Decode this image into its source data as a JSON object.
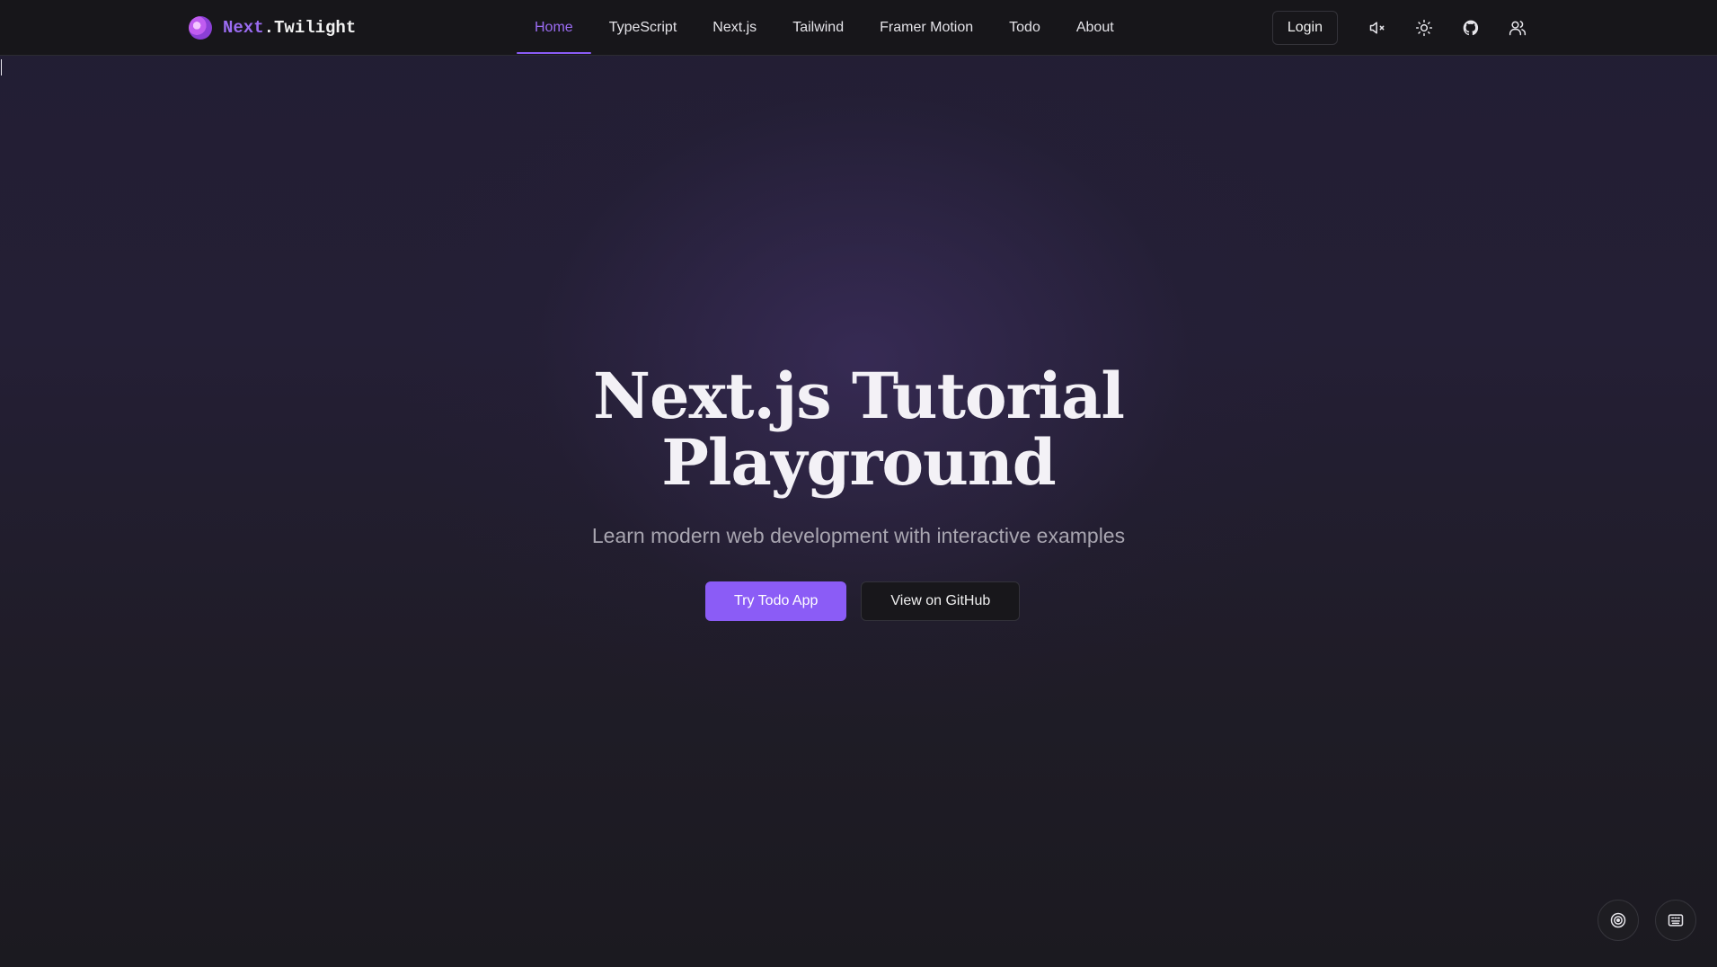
{
  "brand": {
    "prefix": "Next",
    "suffix": ".Twilight",
    "accent_color": "#8b5cf6"
  },
  "nav": {
    "items": [
      {
        "label": "Home",
        "active": true
      },
      {
        "label": "TypeScript",
        "active": false
      },
      {
        "label": "Next.js",
        "active": false
      },
      {
        "label": "Tailwind",
        "active": false
      },
      {
        "label": "Framer Motion",
        "active": false
      },
      {
        "label": "Todo",
        "active": false
      },
      {
        "label": "About",
        "active": false
      }
    ]
  },
  "header_tools": {
    "login_label": "Login",
    "icons": [
      "speaker-muted-icon",
      "sun-icon",
      "github-icon",
      "users-icon"
    ]
  },
  "hero": {
    "title_line1": "Next.js Tutorial",
    "title_line2": "Playground",
    "subtitle": "Learn modern web development with interactive examples",
    "primary_button": "Try Todo App",
    "secondary_button": "View on GitHub"
  },
  "floating_buttons": {
    "icons": [
      "target-icon",
      "keyboard-icon"
    ]
  }
}
